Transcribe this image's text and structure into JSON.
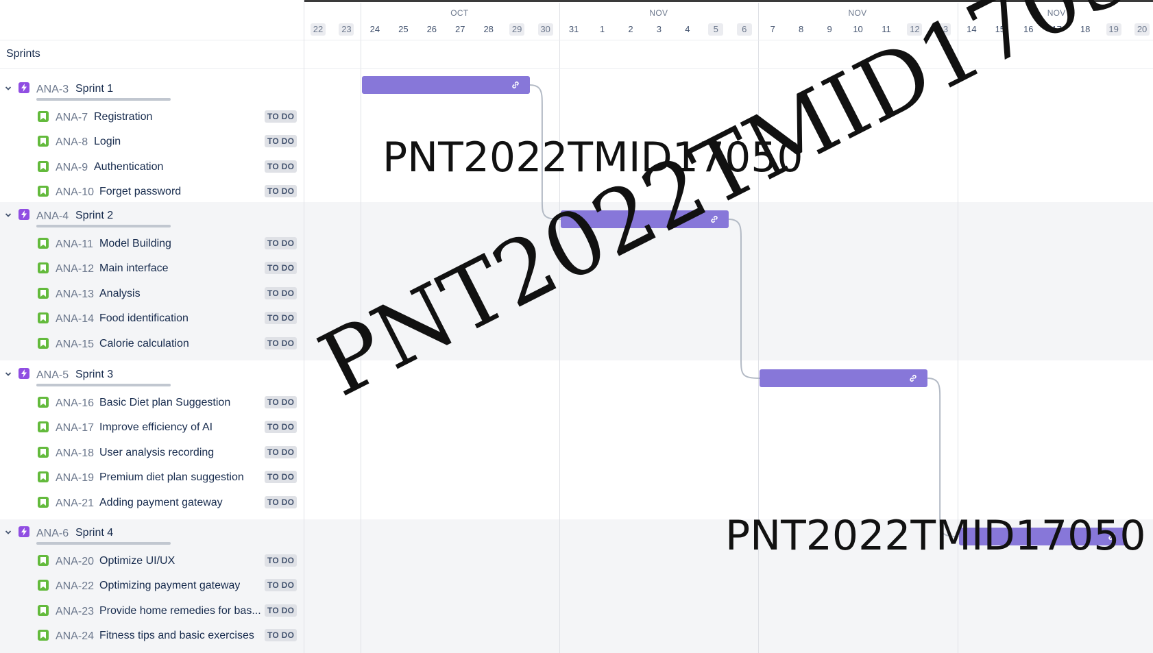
{
  "sidebar": {
    "header": "Sprints",
    "groups": [
      {
        "key": "ANA-3",
        "title": "Sprint 1",
        "items": [
          {
            "key": "ANA-7",
            "title": "Registration",
            "status": "TO DO"
          },
          {
            "key": "ANA-8",
            "title": "Login",
            "status": "TO DO"
          },
          {
            "key": "ANA-9",
            "title": "Authentication",
            "status": "TO DO"
          },
          {
            "key": "ANA-10",
            "title": "Forget password",
            "status": "TO DO"
          }
        ]
      },
      {
        "key": "ANA-4",
        "title": "Sprint 2",
        "items": [
          {
            "key": "ANA-11",
            "title": "Model Building",
            "status": "TO DO"
          },
          {
            "key": "ANA-12",
            "title": "Main interface",
            "status": "TO DO"
          },
          {
            "key": "ANA-13",
            "title": "Analysis",
            "status": "TO DO"
          },
          {
            "key": "ANA-14",
            "title": "Food identification",
            "status": "TO DO"
          },
          {
            "key": "ANA-15",
            "title": "Calorie calculation",
            "status": "TO DO"
          }
        ]
      },
      {
        "key": "ANA-5",
        "title": "Sprint 3",
        "items": [
          {
            "key": "ANA-16",
            "title": "Basic Diet plan Suggestion",
            "status": "TO DO"
          },
          {
            "key": "ANA-17",
            "title": "Improve efficiency of AI",
            "status": "TO DO"
          },
          {
            "key": "ANA-18",
            "title": "User analysis recording",
            "status": "TO DO"
          },
          {
            "key": "ANA-19",
            "title": "Premium diet plan suggestion",
            "status": "TO DO"
          },
          {
            "key": "ANA-21",
            "title": "Adding payment gateway",
            "status": "TO DO"
          }
        ]
      },
      {
        "key": "ANA-6",
        "title": "Sprint 4",
        "items": [
          {
            "key": "ANA-20",
            "title": "Optimize UI/UX",
            "status": "TO DO"
          },
          {
            "key": "ANA-22",
            "title": "Optimizing payment gateway",
            "status": "TO DO"
          },
          {
            "key": "ANA-23",
            "title": "Provide home remedies for bas...",
            "status": "TO DO"
          },
          {
            "key": "ANA-24",
            "title": "Fitness tips and basic exercises",
            "status": "TO DO"
          }
        ]
      }
    ]
  },
  "timeline": {
    "months": [
      {
        "label": "OCT",
        "first_day": "24"
      },
      {
        "label": "NOV",
        "first_day": "31"
      },
      {
        "label": "NOV",
        "first_day": "7"
      },
      {
        "label": "NOV",
        "first_day": "14"
      }
    ],
    "days": [
      {
        "label": "22",
        "weekend": true
      },
      {
        "label": "23",
        "weekend": true
      },
      {
        "label": "24"
      },
      {
        "label": "25"
      },
      {
        "label": "26"
      },
      {
        "label": "27"
      },
      {
        "label": "28"
      },
      {
        "label": "29",
        "weekend": true
      },
      {
        "label": "30",
        "weekend": true
      },
      {
        "label": "31"
      },
      {
        "label": "1"
      },
      {
        "label": "2"
      },
      {
        "label": "3"
      },
      {
        "label": "4"
      },
      {
        "label": "5",
        "weekend": true
      },
      {
        "label": "6",
        "weekend": true
      },
      {
        "label": "7"
      },
      {
        "label": "8"
      },
      {
        "label": "9"
      },
      {
        "label": "10"
      },
      {
        "label": "11"
      },
      {
        "label": "12",
        "weekend": true
      },
      {
        "label": "13",
        "weekend": true
      },
      {
        "label": "14"
      },
      {
        "label": "15"
      },
      {
        "label": "16"
      },
      {
        "label": "17"
      },
      {
        "label": "18"
      },
      {
        "label": "19",
        "weekend": true
      },
      {
        "label": "20",
        "weekend": true
      }
    ],
    "bars": [
      {
        "sprint": "ANA-3",
        "start_day": "24",
        "end_day": "29"
      },
      {
        "sprint": "ANA-4",
        "start_day": "31",
        "end_day": "5"
      },
      {
        "sprint": "ANA-5",
        "start_day": "7",
        "end_day": "12"
      },
      {
        "sprint": "ANA-6",
        "start_day": "14",
        "end_day": "19"
      }
    ]
  },
  "watermark": "PNT2022TMID17050",
  "colors": {
    "bar": "#8777d9",
    "epic": "#904ee2",
    "story": "#63ba3c",
    "lozenge": "#dfe1e6",
    "shade": "#f4f5f7"
  }
}
